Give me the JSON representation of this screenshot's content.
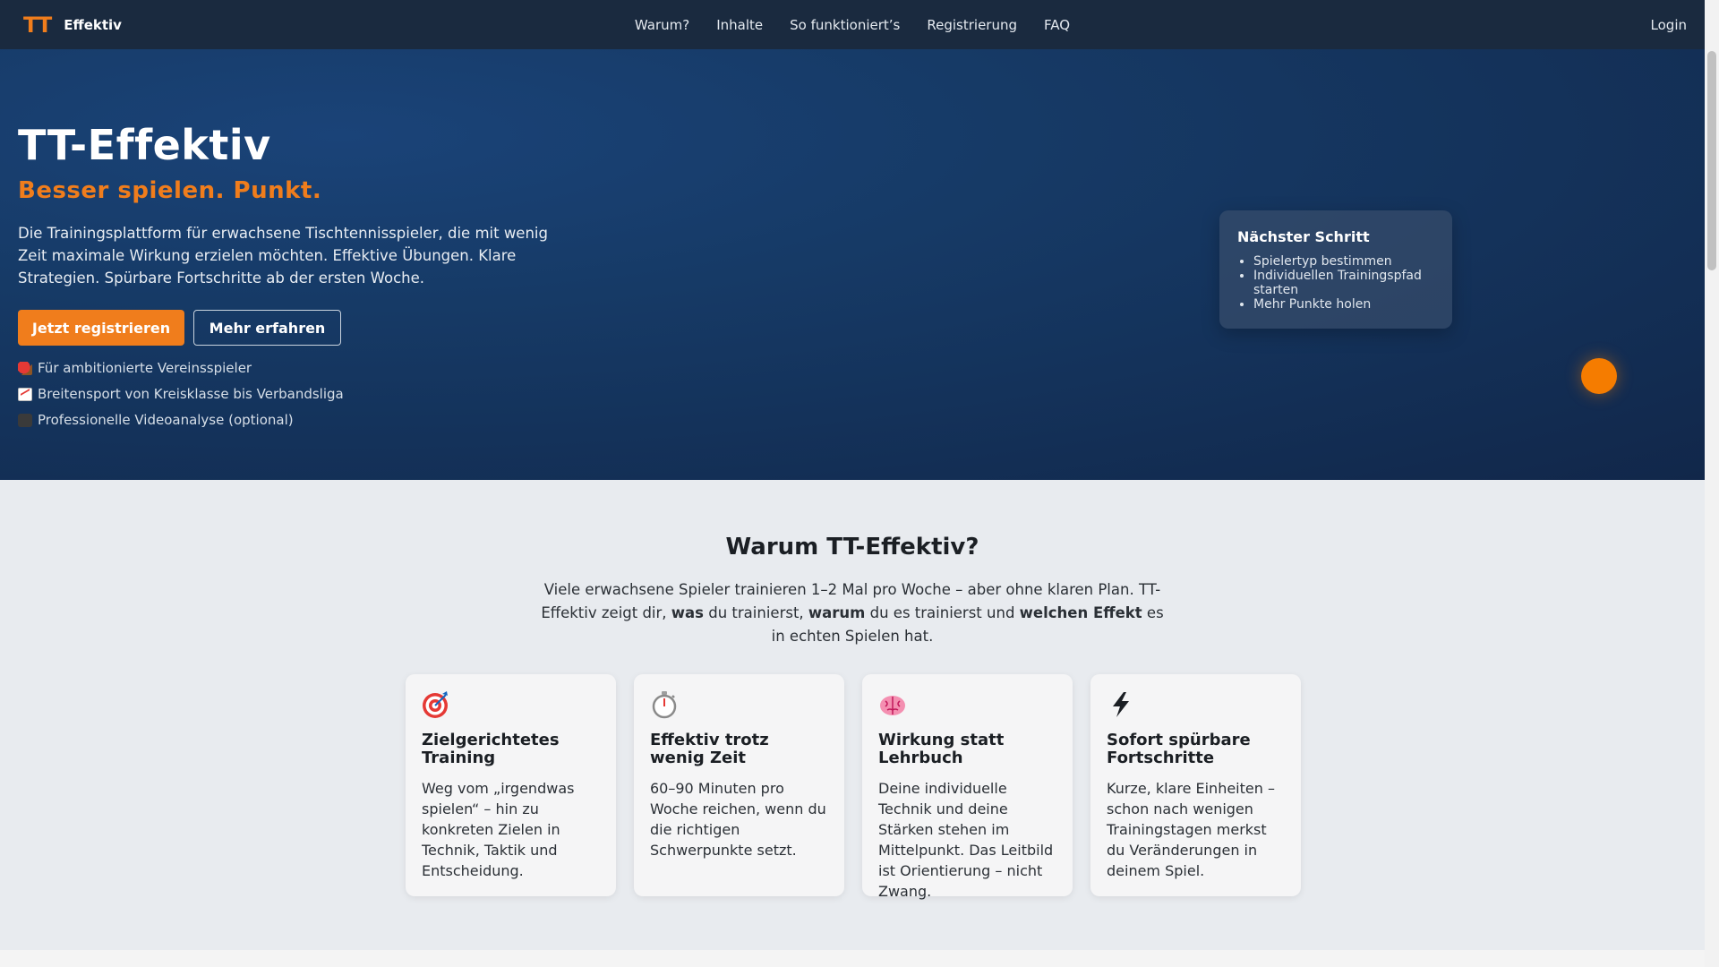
{
  "nav": {
    "brand_mark": "TT",
    "brand_name": "Effektiv",
    "links": [
      "Warum?",
      "Inhalte",
      "So funktioniert’s",
      "Registrierung",
      "FAQ"
    ],
    "login": "Login"
  },
  "hero": {
    "title": "TT-Effektiv",
    "subtitle": "Besser spielen. Punkt.",
    "text": "Die Trainingsplattform für erwachsene Tischtennisspieler, die mit wenig Zeit maximale Wirkung erzielen möchten. Effektive Übungen. Klare Strategien. Spürbare Fortschritte ab der ersten Woche.",
    "cta_primary": "Jetzt registrieren",
    "cta_secondary": "Mehr erfahren",
    "features": [
      {
        "icon": "table-tennis-paddle-icon",
        "text": "Für ambitionierte Vereinsspieler"
      },
      {
        "icon": "chart-increasing-icon",
        "text": "Breitensport von Kreisklasse bis Verbandsliga"
      },
      {
        "icon": "video-camera-icon",
        "text": "Professionelle Videoanalyse (optional)"
      }
    ],
    "next_step": {
      "title": "Nächster Schritt",
      "items": [
        "Spielertyp bestimmen",
        "Individuellen Trainingspfad starten",
        "Mehr Punkte holen"
      ]
    }
  },
  "why": {
    "title": "Warum TT-Effektiv?",
    "text_parts": [
      "Viele erwachsene Spieler trainieren 1–2 Mal pro Woche – aber ohne klaren Plan. TT-Effektiv zeigt dir, ",
      "was",
      " du trainierst, ",
      "warum",
      " du es trainierst und ",
      "welchen Effekt",
      " es in echten Spielen hat."
    ],
    "cards": [
      {
        "icon": "target-icon",
        "title": "Zielgerichtetes Training",
        "text": "Weg vom „irgendwas spielen“ – hin zu konkreten Zielen in Technik, Taktik und Entscheidung."
      },
      {
        "icon": "stopwatch-icon",
        "title": "Effektiv trotz wenig Zeit",
        "text": "60–90 Minuten pro Woche reichen, wenn du die richtigen Schwerpunkte setzt."
      },
      {
        "icon": "brain-icon",
        "title": "Wirkung statt Lehrbuch",
        "text": "Deine individuelle Technik und deine Stärken stehen im Mittelpunkt. Das Leitbild ist Orientierung – nicht Zwang."
      },
      {
        "icon": "lightning-icon",
        "title": "Sofort spürbare Fortschritte",
        "text": "Kurze, klare Einheiten – schon nach wenigen Trainingstagen merkst du Veränderungen in deinem Spiel."
      }
    ]
  },
  "colors": {
    "accent": "#f07d1c",
    "nav_bg": "#1a2a3f",
    "hero_bg": "#163a66",
    "section_bg": "#e8ebef"
  }
}
